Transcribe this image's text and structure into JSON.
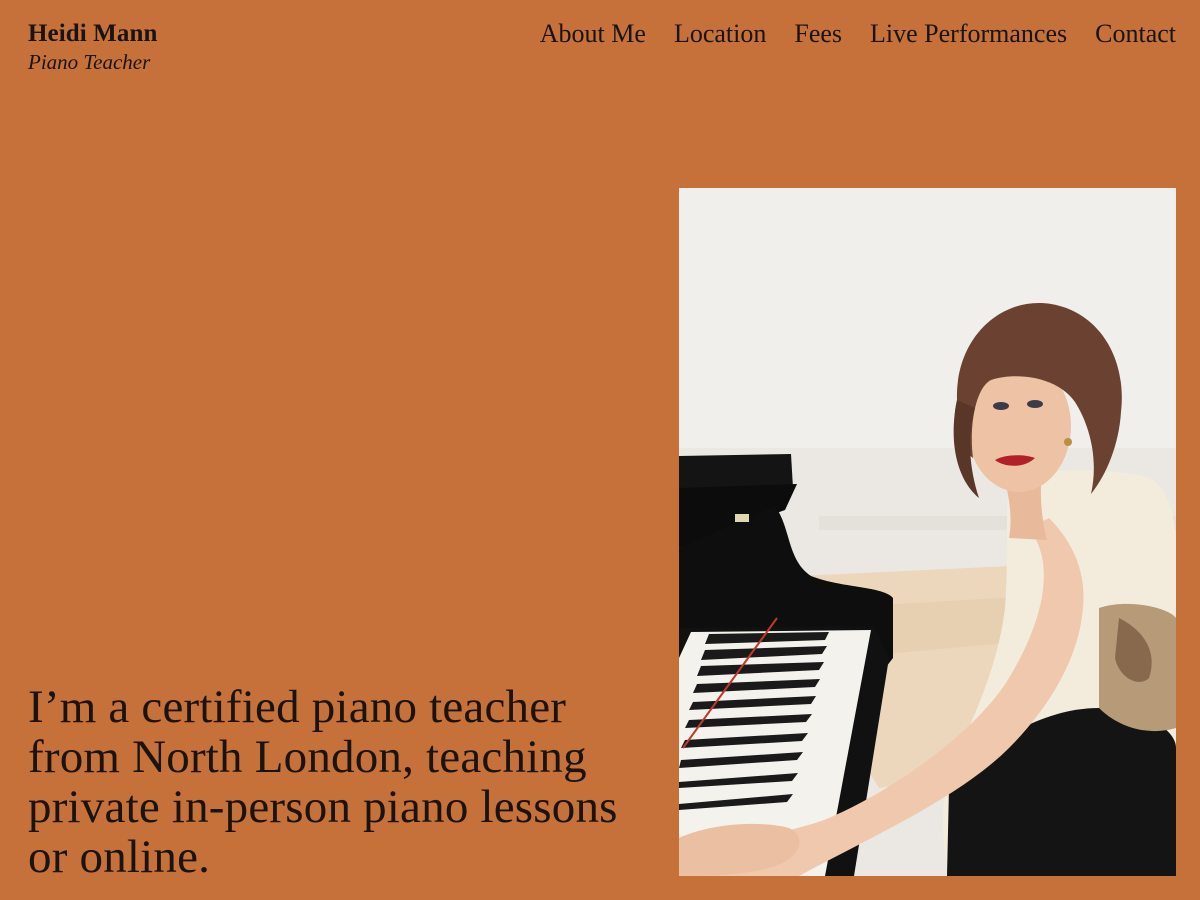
{
  "site": {
    "name": "Heidi Mann",
    "subtitle": "Piano Teacher"
  },
  "nav": {
    "items": [
      {
        "label": "About Me"
      },
      {
        "label": "Location"
      },
      {
        "label": "Fees"
      },
      {
        "label": "Live Performances"
      },
      {
        "label": "Contact"
      }
    ]
  },
  "hero": {
    "text": "I’m a certified piano teacher from North London, teaching private in-person piano lessons or online."
  },
  "colors": {
    "background": "#c6703a",
    "text": "#1a1410"
  }
}
